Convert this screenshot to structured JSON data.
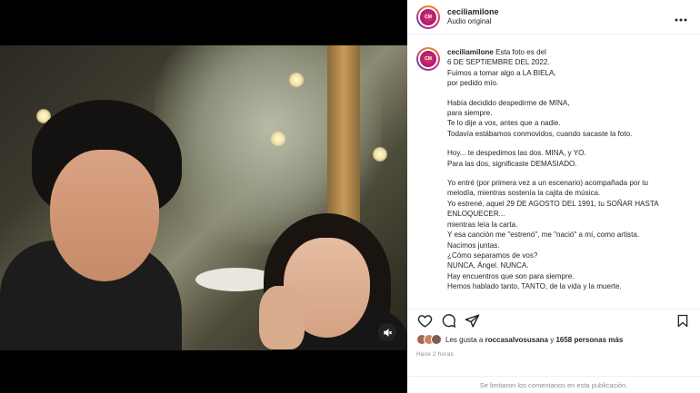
{
  "post": {
    "username": "ceciliamilone",
    "audio": "Audio original",
    "more_label": "...",
    "avatar_text": "CM",
    "caption_username": "ceciliamilone",
    "caption_lines": [
      "Esta foto es del",
      "6 DE SEPTIEMBRE DEL 2022.",
      "Fuimos a tomar algo a LA BIELA,",
      "por pedido mío.",
      "",
      "Había decidido despedirme de MINA,",
      "para siempre.",
      "Te lo dije a vos, antes que a nadie.",
      "Todavía estábamos conmovidos, cuando sacaste la foto.",
      "",
      "Hoy... te despedimos las dos. MINA, y YO.",
      "Para las dos, significaste DEMASIADO.",
      "",
      "Yo entré (por primera vez a un escenario) acompañada por tu",
      "melodía, mientras sostenía la cajita de música.",
      "Yo estrené, aquel 29 DE AGOSTO DEL 1991, tu SOÑAR HASTA",
      "ENLOQUECER...",
      "mientras leía la carta.",
      "Y esa canción me \"estrenó\", me \"nació\" a mí, como artista.",
      "Nacimos juntas.",
      "¿Cómo separamos de vos?",
      "NUNCA, Ángel. NUNCA.",
      "Hay encuentros que son para siempre.",
      "Hemos hablado tanto, TANTO, de la vida y la muerte."
    ],
    "likes_prefix": "Les gusta a",
    "likes_user": "roccasalvosusana",
    "likes_mid": "y",
    "likes_count": "1658 personas más",
    "time": "Hace 2 horas",
    "comments_off": "Se limitaron los comentarios en esta publicación."
  },
  "icons": {
    "heart": "heart-icon",
    "comment": "comment-icon",
    "share": "share-icon",
    "save": "bookmark-icon",
    "mute": "speaker-muted-icon",
    "more": "more-icon"
  },
  "colors": {
    "text": "#262626",
    "muted": "#8e8e8e",
    "border": "#efefef",
    "background": "#ffffff"
  }
}
